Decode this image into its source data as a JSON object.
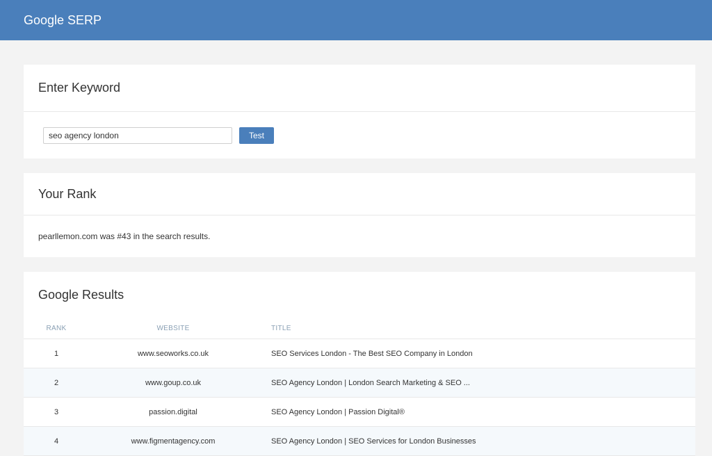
{
  "header": {
    "title": "Google SERP"
  },
  "keyword_card": {
    "title": "Enter Keyword",
    "input_value": "seo agency london",
    "button_label": "Test"
  },
  "rank_card": {
    "title": "Your Rank",
    "message": "pearllemon.com was #43 in the search results."
  },
  "results_card": {
    "title": "Google Results",
    "columns": {
      "rank": "RANK",
      "website": "WEBSITE",
      "title": "TITLE"
    },
    "rows": [
      {
        "rank": "1",
        "website": "www.seoworks.co.uk",
        "title": "SEO Services London - The Best SEO Company in London"
      },
      {
        "rank": "2",
        "website": "www.goup.co.uk",
        "title": "SEO Agency London | London Search Marketing & SEO ..."
      },
      {
        "rank": "3",
        "website": "passion.digital",
        "title": "SEO Agency London | Passion Digital®"
      },
      {
        "rank": "4",
        "website": "www.figmentagency.com",
        "title": "SEO Agency London | SEO Services for London Businesses"
      }
    ]
  },
  "colors": {
    "accent": "#4a7fbb",
    "background": "#f3f3f3",
    "row_alt": "#f5f9fc"
  }
}
